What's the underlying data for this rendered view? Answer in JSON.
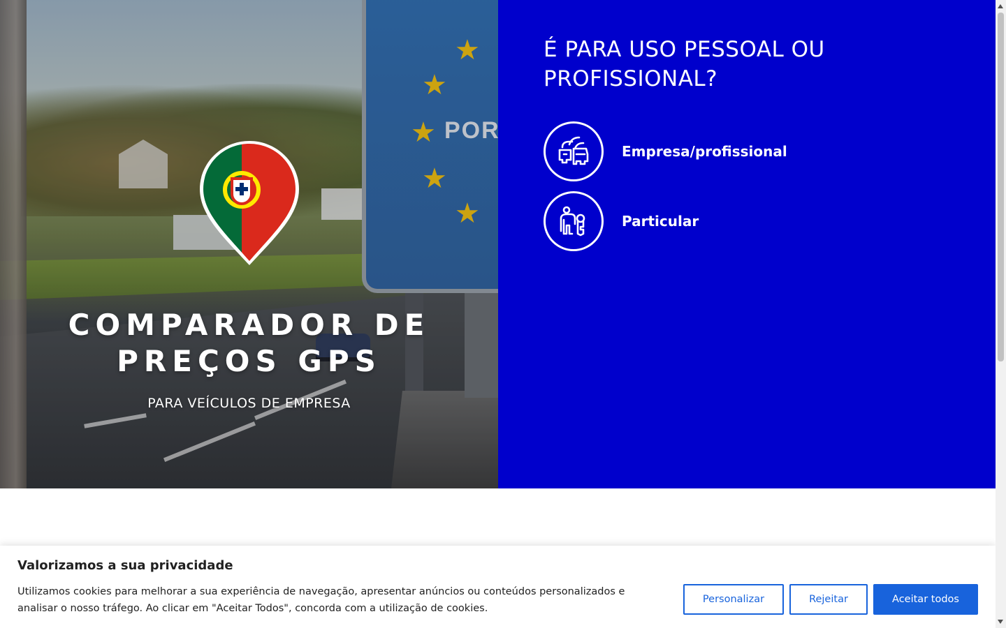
{
  "hero": {
    "title_line1": "COMPARADOR DE",
    "title_line2": "PREÇOS GPS",
    "subtitle": "PARA VEÍCULOS DE EMPRESA",
    "sign_text": "PORT"
  },
  "selector": {
    "question": "É PARA USO PESSOAL OU PROFISSIONAL?",
    "options": [
      {
        "label": "Empresa/profissional",
        "icon": "car-front-icon"
      },
      {
        "label": "Particular",
        "icon": "person-key-icon"
      }
    ],
    "background": "#0000cc"
  },
  "cookie_banner": {
    "title": "Valorizamos a sua privacidade",
    "text": "Utilizamos cookies para melhorar a sua experiência de navegação, apresentar anúncios ou conteúdos personalizados e analisar o nosso tráfego. Ao clicar em \"Aceitar Todos\", concorda com a utilização de cookies.",
    "buttons": {
      "customize": "Personalizar",
      "reject": "Rejeitar",
      "accept": "Aceitar todos"
    },
    "accent": "#1863dc"
  }
}
